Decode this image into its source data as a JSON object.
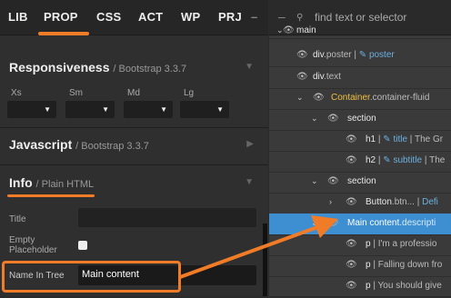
{
  "tabs": [
    "LIB",
    "PROP",
    "CSS",
    "ACT",
    "WP",
    "PRJ"
  ],
  "collapse_symbol": "–",
  "colors": {
    "accent": "#f07c28",
    "selected_row": "#3d8fd1",
    "link": "#6cb0e0",
    "container": "#f0c040"
  },
  "responsiveness": {
    "title": "Responsiveness",
    "sub": "/ Bootstrap 3.3.7",
    "labels": [
      "Xs",
      "Sm",
      "Md",
      "Lg"
    ]
  },
  "javascript": {
    "title": "Javascript",
    "sub": "/ Bootstrap 3.3.7"
  },
  "info": {
    "title": "Info",
    "sub": "/ Plain HTML",
    "title_label": "Title",
    "empty_label_1": "Empty",
    "empty_label_2": "Placeholder",
    "name_label": "Name In Tree",
    "name_value": "Main content"
  },
  "search": {
    "placeholder": "find text or selector"
  },
  "tree": [
    {
      "text": "main",
      "cls": ""
    },
    {
      "text": "div",
      "cls": ".poster",
      "extra": " | ",
      "link": "✎ poster"
    },
    {
      "text": "div",
      "cls": ".text"
    },
    {
      "text": "Container",
      "cls": ".container-fluid"
    },
    {
      "text": "section",
      "cls": ""
    },
    {
      "text": "h1",
      "cls": "",
      "extra": " | ",
      "link": "✎ title",
      "rest": " | The Gr"
    },
    {
      "text": "h2",
      "cls": "",
      "extra": " | ",
      "link": "✎ subtitle",
      "rest": " | The"
    },
    {
      "text": "section",
      "cls": ""
    },
    {
      "text": "Button",
      "cls": ".btn...",
      "extra": " | ",
      "link": "Defi"
    },
    {
      "text": "Main content",
      "cls": ".descripti"
    },
    {
      "text": "p",
      "cls": "",
      "rest": " | I'm a professio"
    },
    {
      "text": "p",
      "cls": "",
      "rest": " | Falling down fro"
    },
    {
      "text": "p",
      "cls": "",
      "rest": " | You should give"
    }
  ]
}
